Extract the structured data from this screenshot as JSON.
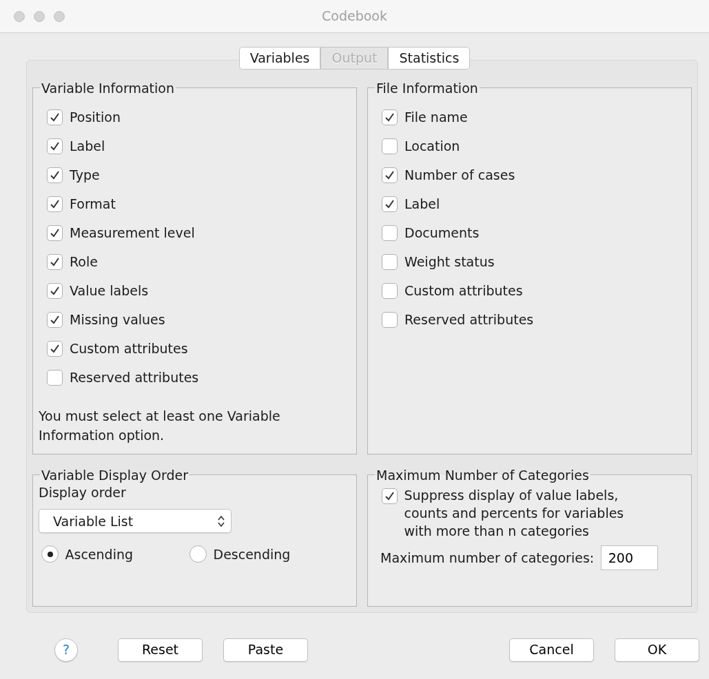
{
  "window": {
    "title": "Codebook"
  },
  "tabs": [
    {
      "label": "Variables",
      "selected": false
    },
    {
      "label": "Output",
      "selected": true
    },
    {
      "label": "Statistics",
      "selected": false
    }
  ],
  "variable_information": {
    "title": "Variable Information",
    "options": [
      {
        "label": "Position",
        "checked": true
      },
      {
        "label": "Label",
        "checked": true
      },
      {
        "label": "Type",
        "checked": true
      },
      {
        "label": "Format",
        "checked": true
      },
      {
        "label": "Measurement level",
        "checked": true
      },
      {
        "label": "Role",
        "checked": true
      },
      {
        "label": "Value labels",
        "checked": true
      },
      {
        "label": "Missing values",
        "checked": true
      },
      {
        "label": "Custom attributes",
        "checked": true
      },
      {
        "label": "Reserved attributes",
        "checked": false
      }
    ],
    "note": "You must select at least one Variable Information option."
  },
  "file_information": {
    "title": "File Information",
    "options": [
      {
        "label": "File name",
        "checked": true
      },
      {
        "label": "Location",
        "checked": false
      },
      {
        "label": "Number of cases",
        "checked": true
      },
      {
        "label": "Label",
        "checked": true
      },
      {
        "label": "Documents",
        "checked": false
      },
      {
        "label": "Weight status",
        "checked": false
      },
      {
        "label": "Custom attributes",
        "checked": false
      },
      {
        "label": "Reserved attributes",
        "checked": false
      }
    ]
  },
  "variable_display_order": {
    "title": "Variable Display Order",
    "display_order_label": "Display order",
    "dropdown": {
      "value": "Variable List"
    },
    "radios": [
      {
        "label": "Ascending",
        "selected": true
      },
      {
        "label": "Descending",
        "selected": false
      }
    ]
  },
  "maximum_number_of_categories": {
    "title": "Maximum Number of Categories",
    "suppress": {
      "label": "Suppress display of value labels, counts and percents for variables with more than n categories",
      "checked": true
    },
    "max_label": "Maximum number of categories:",
    "max_value": "200"
  },
  "help_button": "?",
  "left_buttons": [
    "Reset",
    "Paste"
  ],
  "right_buttons": [
    "Cancel",
    "OK"
  ]
}
